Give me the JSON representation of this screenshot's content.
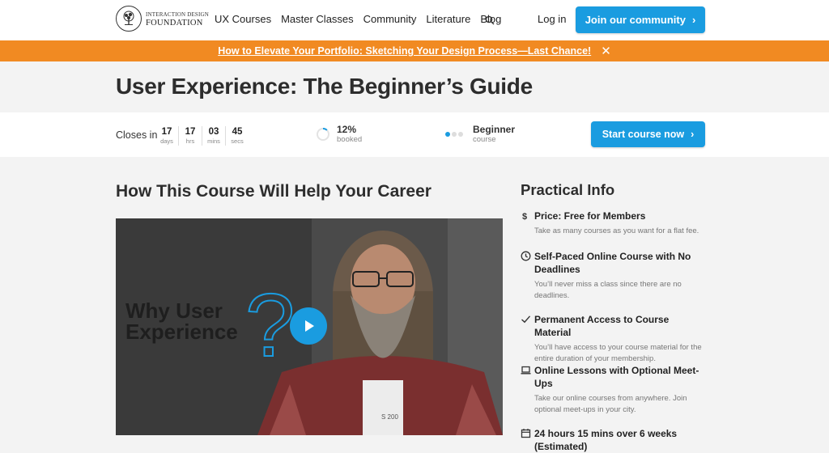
{
  "header": {
    "logo_small": "INTERACTION DESIGN",
    "logo_big": "FOUNDATION",
    "nav": [
      "UX Courses",
      "Master Classes",
      "Community",
      "Literature",
      "Blog"
    ],
    "login_label": "Log in",
    "join_label": "Join our community"
  },
  "banner": {
    "link_text": "How to Elevate Your Portfolio: Sketching Your Design Process—Last Chance!",
    "color": "#f18a22"
  },
  "course": {
    "title": "User Experience: The Beginner’s Guide",
    "closes_label": "Closes in",
    "countdown": [
      {
        "value": "17",
        "unit": "days"
      },
      {
        "value": "17",
        "unit": "hrs"
      },
      {
        "value": "03",
        "unit": "mins"
      },
      {
        "value": "45",
        "unit": "secs"
      }
    ],
    "booked_value": "12%",
    "booked_label": "booked",
    "booked_fraction": 0.12,
    "level_value": "Beginner",
    "level_label": "course",
    "start_label": "Start course now"
  },
  "main": {
    "heading": "How This Course Will Help Your Career",
    "video_text_line1": "Why User",
    "video_text_line2": "Experience",
    "video_qmark": "?",
    "shirt_text": "S 200"
  },
  "practical": {
    "heading": "Practical Info",
    "items": [
      {
        "icon": "dollar-icon",
        "title": "Price: Free for Members",
        "desc": "Take as many courses as you want for a flat fee."
      },
      {
        "icon": "clock-icon",
        "title": "Self-Paced Online Course with No Deadlines",
        "desc": "You’ll never miss a class since there are no deadlines."
      },
      {
        "icon": "checkmark-icon",
        "title": "Permanent Access to Course Material",
        "desc": "You’ll have access to your course material for the entire duration of your membership."
      },
      {
        "icon": "laptop-icon",
        "title": "Online Lessons with Optional Meet-Ups",
        "desc": "Take our online courses from anywhere. Join optional meet-ups in your city."
      },
      {
        "icon": "calendar-icon",
        "title": "24 hours 15 mins over 6 weeks (Estimated)",
        "desc": ""
      }
    ]
  },
  "colors": {
    "accent": "#1a9ce0",
    "banner": "#f18a22"
  }
}
